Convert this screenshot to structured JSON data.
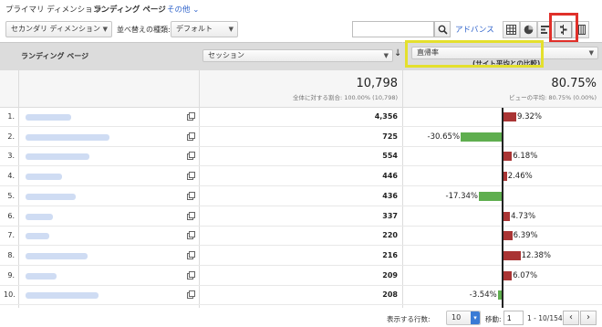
{
  "header": {
    "primary_label": "プライマリ ディメンション：",
    "primary_value": "ランディング ページ",
    "other_link": "その他 ⌄"
  },
  "toolbar": {
    "secondary_dim": "セカンダリ ディメンション",
    "sort_label": "並べ替えの種類:",
    "sort_value": "デフォルト",
    "advanced": "アドバンス"
  },
  "table": {
    "dim_header": "ランディング ページ",
    "metric1_select": "セッション",
    "metric2_select": "直帰率",
    "metric2_sub": "(サイト平均との比較)",
    "total_sessions": "10,798",
    "total_sessions_sub": "全体に対する割合: 100.00% (10,798)",
    "total_bounce": "80.75%",
    "total_bounce_sub": "ビューの平均: 80.75% (0.00%)",
    "rows": [
      {
        "n": "1.",
        "sessions": "4,356",
        "pct": "9.32%",
        "value": 9.32
      },
      {
        "n": "2.",
        "sessions": "725",
        "pct": "-30.65%",
        "value": -30.65
      },
      {
        "n": "3.",
        "sessions": "554",
        "pct": "6.18%",
        "value": 6.18
      },
      {
        "n": "4.",
        "sessions": "446",
        "pct": "2.46%",
        "value": 2.46
      },
      {
        "n": "5.",
        "sessions": "436",
        "pct": "-17.34%",
        "value": -17.34
      },
      {
        "n": "6.",
        "sessions": "337",
        "pct": "4.73%",
        "value": 4.73
      },
      {
        "n": "7.",
        "sessions": "220",
        "pct": "6.39%",
        "value": 6.39
      },
      {
        "n": "8.",
        "sessions": "216",
        "pct": "12.38%",
        "value": 12.38
      },
      {
        "n": "9.",
        "sessions": "209",
        "pct": "6.07%",
        "value": 6.07
      },
      {
        "n": "10.",
        "sessions": "208",
        "pct": "-3.54%",
        "value": -3.54
      }
    ]
  },
  "footer": {
    "rows_label": "表示する行数:",
    "rows_value": "10",
    "goto_label": "移動:",
    "goto_value": "1",
    "range": "1 - 10/154"
  },
  "colors": {
    "positive": "#a93434",
    "negative": "#5fae4f",
    "highlight_yellow": "#e4e02d",
    "highlight_red": "#e0302a"
  }
}
